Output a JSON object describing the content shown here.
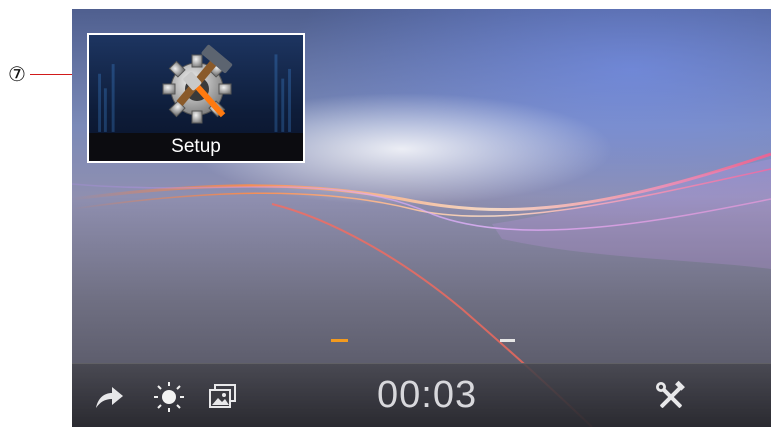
{
  "callout": {
    "number": "⑦"
  },
  "app_tile": {
    "label": "Setup",
    "icon": "setup-hammer-gear-icon"
  },
  "pager": {
    "pages": 2,
    "active_page": 1
  },
  "bottom_bar": {
    "time": "00:03",
    "icons": [
      "forward-arrow-icon",
      "brightness-icon",
      "gallery-icon",
      "tools-icon"
    ]
  },
  "colors": {
    "accent": "#f39a1e",
    "callout_line": "#d11a1a"
  }
}
